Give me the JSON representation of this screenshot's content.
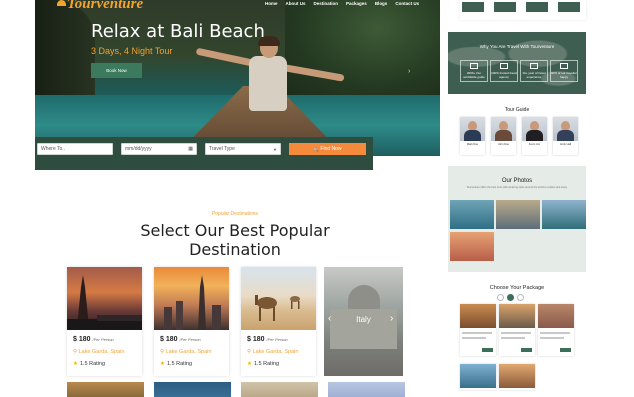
{
  "brand": {
    "name": "Tourventure"
  },
  "nav": [
    "Home",
    "About Us",
    "Destination",
    "Packages",
    "Blogs",
    "Contact Us"
  ],
  "hero": {
    "title": "Relax at Bali Beach",
    "subtitle": "3 Days, 4 Night Tour",
    "cta": "Book Now",
    "next_arrow": "›"
  },
  "search": {
    "where_placeholder": "Where To..",
    "date_placeholder": "mm/dd/yyyy",
    "type_placeholder": "Travel Type",
    "find_label": "Find Now",
    "search_glyph": "🔍"
  },
  "popular": {
    "kicker": "Popular Destinations",
    "title": "Select Our Best Popular Destination",
    "cards": [
      {
        "price": "$ 180",
        "per": "/Per Person",
        "location": "Lake Garda, Spain",
        "rating": "1.5 Rating"
      },
      {
        "price": "$ 180",
        "per": "/Per Person",
        "location": "Lake Garda, Spain",
        "rating": "1.5 Rating"
      },
      {
        "price": "$ 180",
        "per": "/Per Person",
        "location": "Lake Garda, Spain",
        "rating": "1.5 Rating"
      }
    ],
    "featured": {
      "label": "Italy",
      "prev": "‹",
      "next": "›"
    }
  },
  "right": {
    "why_title": "Why You Are Travel With Tourventure",
    "why_features": [
      "2000+ Our worldwide guide",
      "100% trusted travel agency",
      "10+ year of travel experience",
      "90% of our traveller happy"
    ],
    "guide_title": "Tour Guide",
    "guides": [
      "Mark Doe",
      "John Doe",
      "Kevin Jon",
      "Andy Hall"
    ],
    "photos_title": "Our Photos",
    "photos_sub": "Tourventure offers the best tours with amazing spots around the world to explore and enjoy.",
    "package_title": "Choose Your Package"
  },
  "colors": {
    "accent": "#f58a3c",
    "brand_green": "#2e4d3f",
    "gold": "#f2a43a"
  }
}
